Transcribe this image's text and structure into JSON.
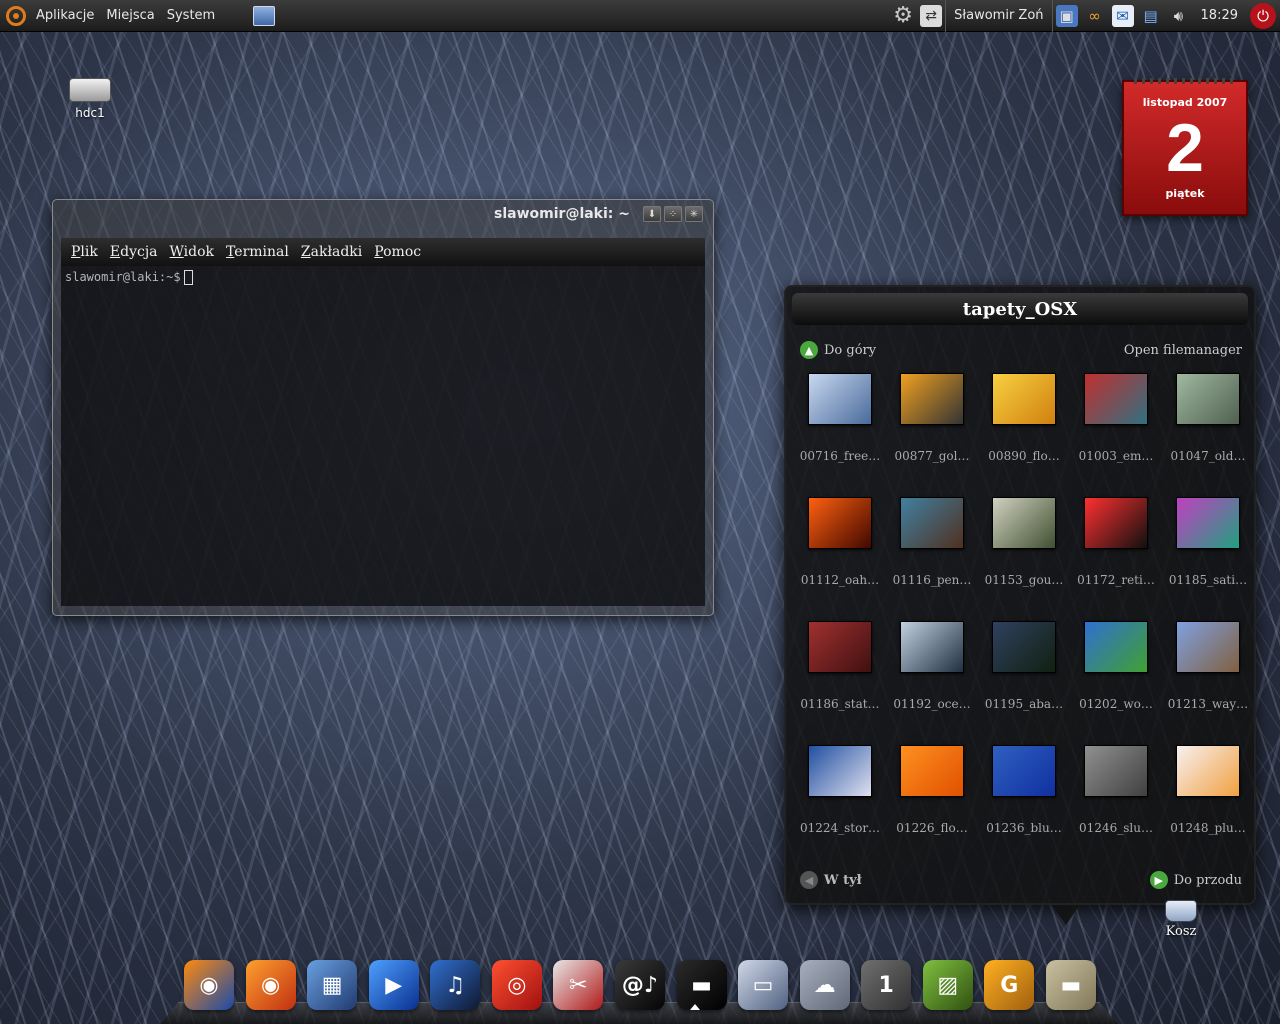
{
  "top_panel": {
    "menus": [
      "Aplikacje",
      "Miejsca",
      "System"
    ],
    "user_name": "Sławomir Zoń",
    "clock": "18:29",
    "tray_icons": [
      "gear-icon",
      "user-switch-icon",
      "network-icon",
      "weather-icon",
      "mail-icon",
      "network-manager-icon",
      "volume-icon"
    ]
  },
  "desktop": {
    "drive_label": "hdc1",
    "trash_label": "Kosz"
  },
  "calendar": {
    "month": "listopad 2007",
    "day": "2",
    "weekday": "piątek"
  },
  "terminal": {
    "title": "slawomir@laki: ~",
    "menu": [
      "Plik",
      "Edycja",
      "Widok",
      "Terminal",
      "Zakładki",
      "Pomoc"
    ],
    "prompt": "slawomir@laki:~$"
  },
  "stack": {
    "title": "tapety_OSX",
    "up_label": "Do góry",
    "open_fm_label": "Open filemanager",
    "back_label": "W tył",
    "forward_label": "Do przodu",
    "files": [
      {
        "label": "00716_free…",
        "colors": [
          "#c8d8f0",
          "#4a6a9a"
        ]
      },
      {
        "label": "00877_gol…",
        "colors": [
          "#f0a020",
          "#333333"
        ]
      },
      {
        "label": "00890_flo…",
        "colors": [
          "#f8d040",
          "#d08010"
        ]
      },
      {
        "label": "01003_em…",
        "colors": [
          "#c03030",
          "#307080"
        ]
      },
      {
        "label": "01047_old…",
        "colors": [
          "#a0b8a0",
          "#506050"
        ]
      },
      {
        "label": "01112_oah…",
        "colors": [
          "#ff6010",
          "#400800"
        ]
      },
      {
        "label": "01116_pen…",
        "colors": [
          "#4080a0",
          "#503020"
        ]
      },
      {
        "label": "01153_gou…",
        "colors": [
          "#d0d0c0",
          "#405030"
        ]
      },
      {
        "label": "01172_reti…",
        "colors": [
          "#ff3030",
          "#101010"
        ]
      },
      {
        "label": "01185_sati…",
        "colors": [
          "#c040c0",
          "#20a080"
        ]
      },
      {
        "label": "01186_stat…",
        "colors": [
          "#a03030",
          "#401010"
        ]
      },
      {
        "label": "01192_oce…",
        "colors": [
          "#c0d0e0",
          "#203040"
        ]
      },
      {
        "label": "01195_aba…",
        "colors": [
          "#304060",
          "#102010"
        ]
      },
      {
        "label": "01202_wo…",
        "colors": [
          "#3070d0",
          "#40a030"
        ]
      },
      {
        "label": "01213_way…",
        "colors": [
          "#80a0e0",
          "#806040"
        ]
      },
      {
        "label": "01224_stor…",
        "colors": [
          "#2050a0",
          "#e0e0f0"
        ]
      },
      {
        "label": "01226_flo…",
        "colors": [
          "#ff9020",
          "#e05000"
        ]
      },
      {
        "label": "01236_blu…",
        "colors": [
          "#3060c0",
          "#1030a0"
        ]
      },
      {
        "label": "01246_slu…",
        "colors": [
          "#909090",
          "#404040"
        ]
      },
      {
        "label": "01248_plu…",
        "colors": [
          "#f8f0f0",
          "#f0a040"
        ]
      }
    ]
  },
  "dock": [
    {
      "name": "firefox-icon",
      "glyph": "◉",
      "colors": [
        "#ff8a10",
        "#1a4aa8"
      ]
    },
    {
      "name": "firefox-alt-icon",
      "glyph": "◉",
      "colors": [
        "#ffa030",
        "#c03010"
      ]
    },
    {
      "name": "video-editor-icon",
      "glyph": "▦",
      "colors": [
        "#6aa0e0",
        "#203a70"
      ]
    },
    {
      "name": "media-player-icon",
      "glyph": "▶",
      "colors": [
        "#4ea0ff",
        "#0a3090"
      ]
    },
    {
      "name": "music-player-icon",
      "glyph": "♫",
      "colors": [
        "#3070d0",
        "#101830"
      ]
    },
    {
      "name": "cd-burner-icon",
      "glyph": "◎",
      "colors": [
        "#ff5030",
        "#a01010"
      ]
    },
    {
      "name": "screenshot-tool-icon",
      "glyph": "✂",
      "colors": [
        "#e8e8e8",
        "#b01818"
      ]
    },
    {
      "name": "system-monitor-icon",
      "glyph": "@♪",
      "colors": [
        "#3a3a3a",
        "#050505"
      ]
    },
    {
      "name": "terminal-icon",
      "glyph": "▬",
      "colors": [
        "#2a2a2a",
        "#000000"
      ]
    },
    {
      "name": "hard-drive-icon",
      "glyph": "▭",
      "colors": [
        "#d0d8e8",
        "#506080"
      ]
    },
    {
      "name": "weather-icon",
      "glyph": "☁",
      "colors": [
        "#a8b0c0",
        "#606878"
      ]
    },
    {
      "name": "workspace-switcher-icon",
      "glyph": "1",
      "colors": [
        "#707070",
        "#303030"
      ]
    },
    {
      "name": "image-viewer-icon",
      "glyph": "▨",
      "colors": [
        "#80c040",
        "#305010"
      ]
    },
    {
      "name": "gimp-icon",
      "glyph": "G",
      "colors": [
        "#ffb020",
        "#a06010"
      ]
    },
    {
      "name": "folder-icon",
      "glyph": "▬",
      "colors": [
        "#c8c0a0",
        "#807858"
      ]
    }
  ],
  "colors": {
    "accent_green": "#4aa83e",
    "calendar_red": "#d22a2a",
    "power_red": "#b5121b"
  }
}
